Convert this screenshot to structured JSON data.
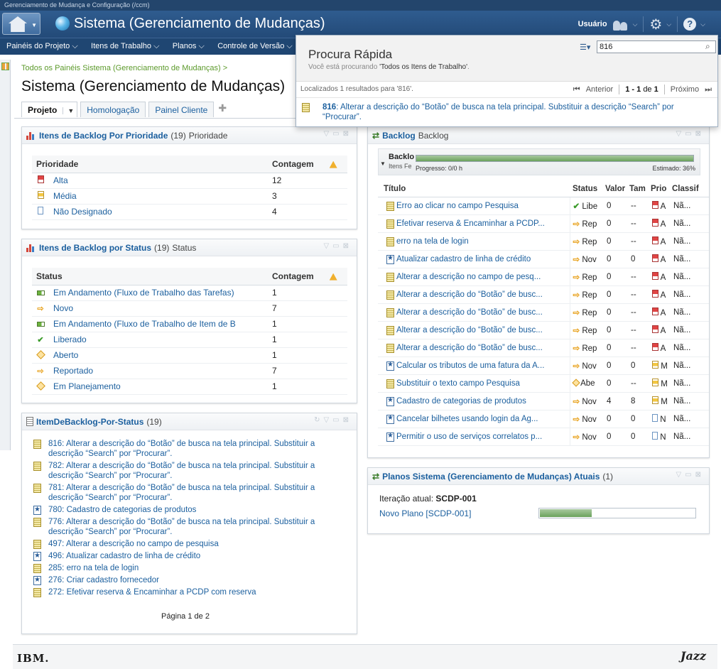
{
  "window": {
    "title": "Gerenciamento de Mudança e Configuração (/ccm)"
  },
  "header": {
    "app_title": "Sistema (Gerenciamento de Mudanças)",
    "user_label": "Usuário"
  },
  "menu": [
    "Painéis do Projeto",
    "Itens de Trabalho",
    "Planos",
    "Controle de Versão"
  ],
  "breadcrumb": "Todos os Painéis Sistema (Gerenciamento de Mudanças) >",
  "page_title": "Sistema (Gerenciamento de Mudanças)",
  "tabs": [
    "Projeto",
    "Homologação",
    "Painel Cliente"
  ],
  "widget_priority": {
    "title": "Itens de Backlog Por Prioridade",
    "count": "(19)",
    "subtitle": "Prioridade",
    "col_label": "Prioridade",
    "col_count": "Contagem",
    "rows": [
      {
        "label": "Alta",
        "count": "12",
        "icon": "priority-high"
      },
      {
        "label": "Média",
        "count": "3",
        "icon": "priority-medium"
      },
      {
        "label": "Não Designado",
        "count": "4",
        "icon": "priority-unassigned"
      }
    ]
  },
  "widget_status": {
    "title": "Itens de Backlog por Status",
    "count": "(19)",
    "subtitle": "Status",
    "col_label": "Status",
    "col_count": "Contagem",
    "rows": [
      {
        "label": "Em Andamento (Fluxo de Trabalho das Tarefas)",
        "count": "1",
        "icon": "in-progress"
      },
      {
        "label": "Novo",
        "count": "7",
        "icon": "arrow"
      },
      {
        "label": "Em Andamento (Fluxo de Trabalho de Item de B",
        "count": "1",
        "icon": "in-progress"
      },
      {
        "label": "Liberado",
        "count": "1",
        "icon": "check"
      },
      {
        "label": "Aberto",
        "count": "1",
        "icon": "diamond"
      },
      {
        "label": "Reportado",
        "count": "7",
        "icon": "arrow"
      },
      {
        "label": "Em Planejamento",
        "count": "1",
        "icon": "diamond"
      }
    ]
  },
  "widget_items": {
    "title": "ItemDeBacklog-Por-Status",
    "count": "(19)",
    "items": [
      {
        "text": "816: Alterar a descrição do “Botão” de busca na tela principal. Substituir a descrição “Search” por “Procurar”.",
        "icon": "story"
      },
      {
        "text": "782: Alterar a descrição do “Botão” de busca na tela principal. Substituir a descrição “Search” por “Procurar”.",
        "icon": "story"
      },
      {
        "text": "781: Alterar a descrição do “Botão” de busca na tela principal. Substituir a descrição “Search” por “Procurar”.",
        "icon": "story"
      },
      {
        "text": "780: Cadastro de categorias de produtos",
        "icon": "task"
      },
      {
        "text": "776: Alterar a descrição do “Botão” de busca na tela principal. Substituir a descrição “Search” por “Procurar”.",
        "icon": "story"
      },
      {
        "text": "497: Alterar a descrição no campo de pesquisa",
        "icon": "story"
      },
      {
        "text": "496: Atualizar cadastro de linha de crédito",
        "icon": "task"
      },
      {
        "text": "285: erro na tela de login",
        "icon": "story"
      },
      {
        "text": "276: Criar cadastro fornecedor",
        "icon": "task"
      },
      {
        "text": "272: Efetivar reserva & Encaminhar a PCDP com reserva",
        "icon": "story"
      }
    ],
    "pager": "Página 1 de 2"
  },
  "widget_backlog": {
    "title": "Backlog",
    "subtitle": "Backlog",
    "group_title": "Backlo",
    "group_sub": "Itens Fe",
    "progress_left": "Progresso: 0/0 h",
    "progress_right": "Estimado: 36%",
    "progress_fraction": 1.0,
    "columns": [
      "Título",
      "Status",
      "Valor",
      "Tam",
      "Prio",
      "Classif"
    ],
    "rows": [
      {
        "title": "Erro ao clicar no campo Pesquisa",
        "status": "Libe",
        "status_icon": "check",
        "valor": "0",
        "tam": "--",
        "prio_icon": "high",
        "prio": "A",
        "classif": "Nã..."
      },
      {
        "title": "Efetivar reserva & Encaminhar a PCDP...",
        "status": "Rep",
        "status_icon": "arrow",
        "valor": "0",
        "tam": "--",
        "prio_icon": "high",
        "prio": "A",
        "classif": "Nã..."
      },
      {
        "title": "erro na tela de login",
        "status": "Rep",
        "status_icon": "arrow",
        "valor": "0",
        "tam": "--",
        "prio_icon": "high",
        "prio": "A",
        "classif": "Nã..."
      },
      {
        "title": "Atualizar cadastro de linha de crédito",
        "status": "Nov",
        "status_icon": "arrow",
        "valor": "0",
        "tam": "0",
        "prio_icon": "high",
        "prio": "A",
        "classif": "Nã..."
      },
      {
        "title": "Alterar a descrição no campo de pesq...",
        "status": "Rep",
        "status_icon": "arrow",
        "valor": "0",
        "tam": "--",
        "prio_icon": "high",
        "prio": "A",
        "classif": "Nã..."
      },
      {
        "title": "Alterar a descrição do “Botão” de busc...",
        "status": "Rep",
        "status_icon": "arrow",
        "valor": "0",
        "tam": "--",
        "prio_icon": "high",
        "prio": "A",
        "classif": "Nã..."
      },
      {
        "title": "Alterar a descrição do “Botão” de busc...",
        "status": "Rep",
        "status_icon": "arrow",
        "valor": "0",
        "tam": "--",
        "prio_icon": "high",
        "prio": "A",
        "classif": "Nã..."
      },
      {
        "title": "Alterar a descrição do “Botão” de busc...",
        "status": "Rep",
        "status_icon": "arrow",
        "valor": "0",
        "tam": "--",
        "prio_icon": "high",
        "prio": "A",
        "classif": "Nã..."
      },
      {
        "title": "Alterar a descrição do “Botão” de busc...",
        "status": "Rep",
        "status_icon": "arrow",
        "valor": "0",
        "tam": "--",
        "prio_icon": "high",
        "prio": "A",
        "classif": "Nã..."
      },
      {
        "title": "Calcular os tributos de uma fatura da A...",
        "status": "Nov",
        "status_icon": "arrow",
        "valor": "0",
        "tam": "0",
        "prio_icon": "medium",
        "prio": "M",
        "classif": "Nã..."
      },
      {
        "title": "Substituir o texto campo Pesquisa",
        "status": "Abe",
        "status_icon": "diamond",
        "valor": "0",
        "tam": "--",
        "prio_icon": "medium",
        "prio": "M",
        "classif": "Nã..."
      },
      {
        "title": "Cadastro de categorias de produtos",
        "status": "Nov",
        "status_icon": "arrow",
        "valor": "4",
        "tam": "8",
        "prio_icon": "medium",
        "prio": "M",
        "classif": "Nã..."
      },
      {
        "title": "Cancelar  bilhetes usando login da Ag...",
        "status": "Nov",
        "status_icon": "arrow",
        "valor": "0",
        "tam": "0",
        "prio_icon": "none",
        "prio": "N",
        "classif": "Nã..."
      },
      {
        "title": "Permitir o uso de serviços correlatos p...",
        "status": "Nov",
        "status_icon": "arrow",
        "valor": "0",
        "tam": "0",
        "prio_icon": "none",
        "prio": "N",
        "classif": "Nã..."
      }
    ]
  },
  "widget_plans": {
    "title": "Planos Sistema (Gerenciamento de Mudanças) Atuais",
    "count": "(1)",
    "iter_label": "Iteração atual:",
    "iter_value": "SCDP-001",
    "plan_link": "Novo Plano [SCDP-001]",
    "plan_progress": 0.33
  },
  "quick_search": {
    "title": "Procura Rápida",
    "scope_prefix": "Você está procurando",
    "scope_value": "'Todos os Itens de Trabalho'",
    "scope_suffix": ".",
    "query": "816",
    "found_text": "Localizados 1 resultados para '816'.",
    "prev": "Anterior",
    "range": "1 - 1",
    "of_label": "de",
    "total": "1",
    "next": "Próximo",
    "result_id": "816",
    "result_text": ": Alterar a descrição do “Botão” de busca na tela principal. Substituir a descrição “Search” por “Procurar”."
  },
  "footer": {
    "left": "IBM.",
    "right": "Jazz"
  }
}
